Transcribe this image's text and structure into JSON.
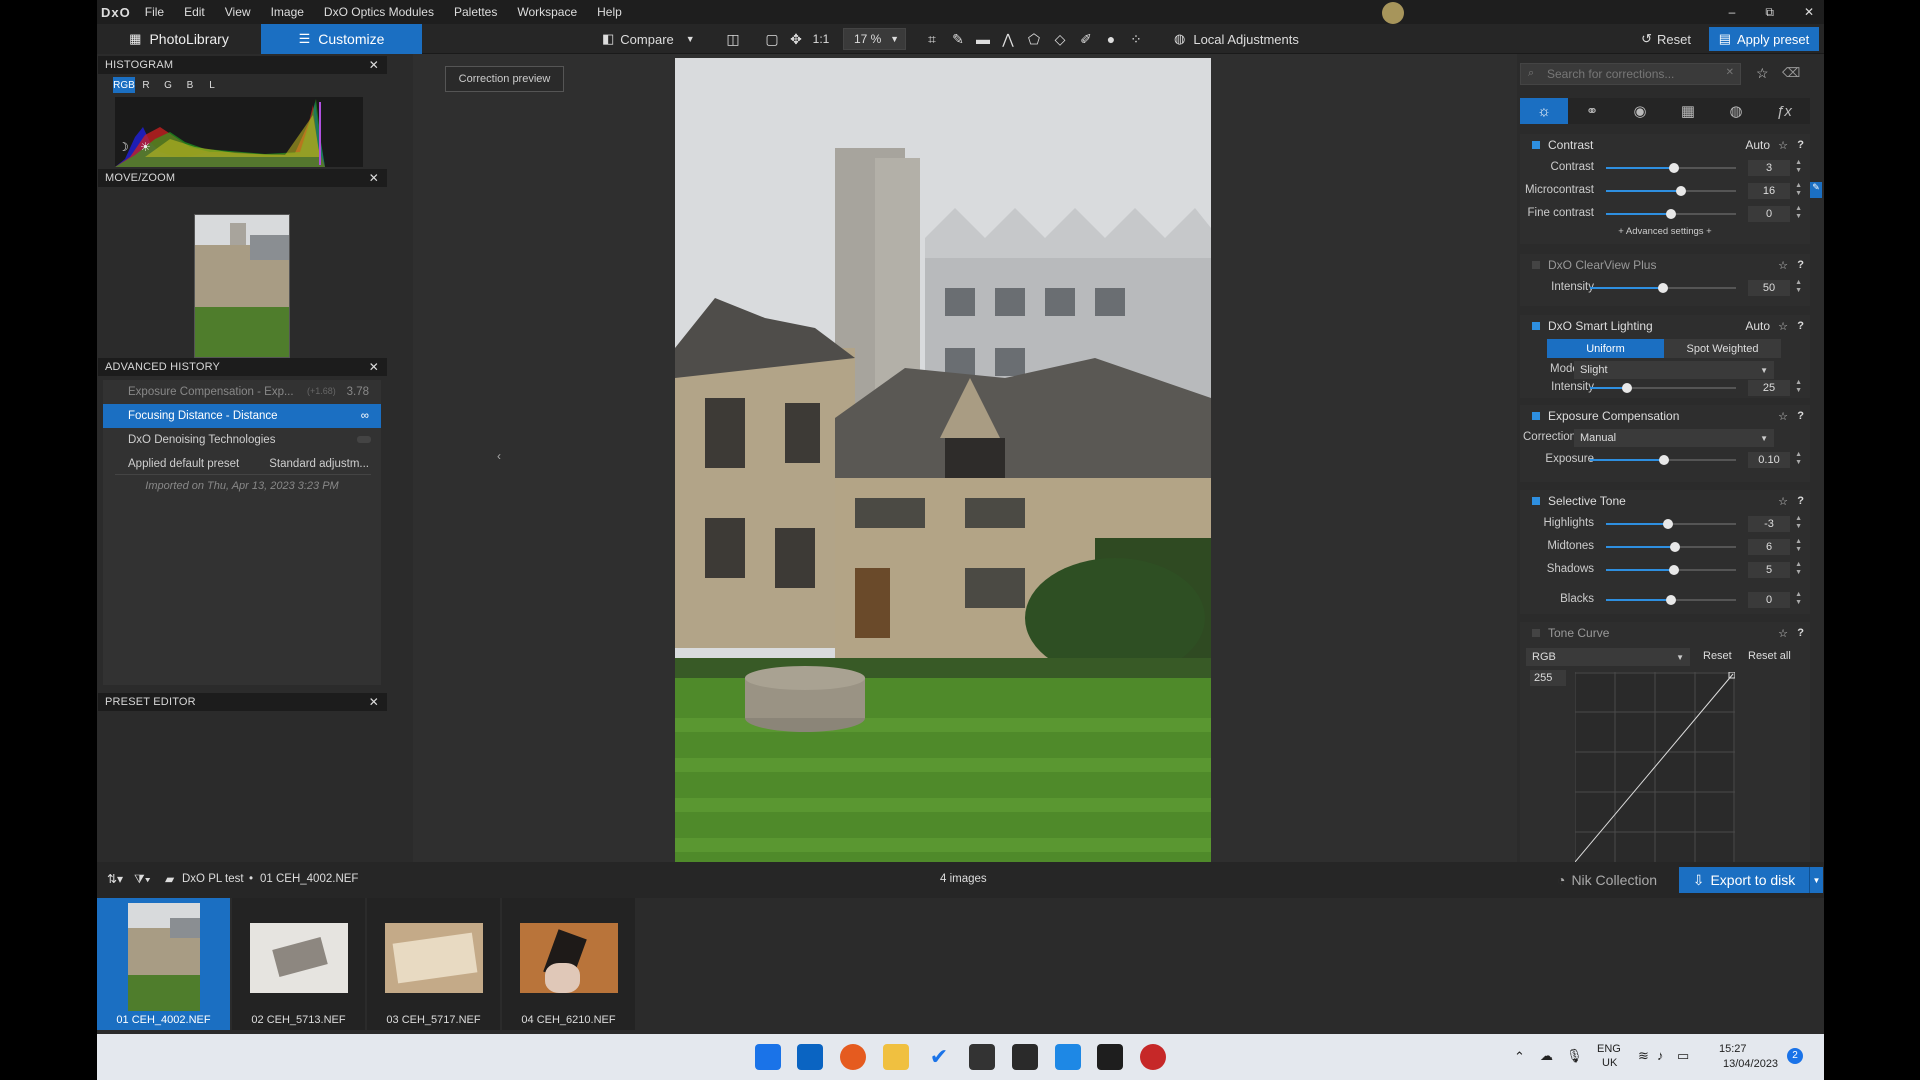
{
  "app": {
    "logo": "DxO"
  },
  "menu": [
    "File",
    "Edit",
    "View",
    "Image",
    "DxO Optics Modules",
    "Palettes",
    "Workspace",
    "Help"
  ],
  "window_controls": {
    "minimize": "–",
    "maximize": "⧉",
    "close": "✕"
  },
  "toolbar": {
    "tab_photolibrary": "PhotoLibrary",
    "tab_customize": "Customize",
    "compare": "Compare",
    "one_to_one": "1:1",
    "zoom": "17 %",
    "local_adjustments": "Local Adjustments",
    "reset": "Reset",
    "apply_preset": "Apply preset"
  },
  "left": {
    "histogram": {
      "title": "HISTOGRAM",
      "channels": [
        "RGB",
        "R",
        "G",
        "B",
        "L"
      ],
      "active_channel": "RGB"
    },
    "move_zoom": {
      "title": "MOVE/ZOOM"
    },
    "history": {
      "title": "ADVANCED HISTORY",
      "items": [
        {
          "label": "Exposure Compensation - Exp...",
          "from": "(+1.68)",
          "value": "3.78"
        },
        {
          "label": "Focusing Distance - Distance",
          "value": "∞"
        },
        {
          "label": "DxO Denoising Technologies",
          "value": ""
        },
        {
          "label": "Applied default preset",
          "value": "Standard adjustm..."
        }
      ],
      "imported": "Imported on Thu, Apr 13, 2023 3:23 PM"
    },
    "preset_editor": {
      "title": "PRESET EDITOR"
    }
  },
  "viewer": {
    "correction_preview": "Correction preview"
  },
  "right": {
    "search_placeholder": "Search for corrections...",
    "contrast": {
      "title": "Contrast",
      "auto": "Auto",
      "advanced": "+ Advanced settings +",
      "rows": [
        {
          "label": "Contrast",
          "value": "3",
          "level": 0.52
        },
        {
          "label": "Microcontrast",
          "value": "16",
          "level": 0.58
        },
        {
          "label": "Fine contrast",
          "value": "0",
          "level": 0.5
        }
      ]
    },
    "clearview": {
      "title": "DxO ClearView Plus",
      "rows": [
        {
          "label": "Intensity",
          "value": "50",
          "level": 0.5
        }
      ]
    },
    "smart_lighting": {
      "title": "DxO Smart Lighting",
      "auto": "Auto",
      "mode_uniform": "Uniform",
      "mode_spot": "Spot Weighted",
      "mode_label": "Mode",
      "mode_value": "Slight",
      "rows": [
        {
          "label": "Intensity",
          "value": "25",
          "level": 0.25
        }
      ]
    },
    "exposure": {
      "title": "Exposure Compensation",
      "correction_label": "Correction",
      "correction_value": "Manual",
      "rows": [
        {
          "label": "Exposure",
          "value": "0.10",
          "level": 0.51
        }
      ]
    },
    "selective_tone": {
      "title": "Selective Tone",
      "rows": [
        {
          "label": "Highlights",
          "value": "-3",
          "level": 0.48
        },
        {
          "label": "Midtones",
          "value": "6",
          "level": 0.53
        },
        {
          "label": "Shadows",
          "value": "5",
          "level": 0.52
        },
        {
          "label": "Blacks",
          "value": "0",
          "level": 0.5
        }
      ]
    },
    "tone_curve": {
      "title": "Tone Curve",
      "channel": "RGB",
      "reset": "Reset",
      "reset_all": "Reset all",
      "value": "255"
    }
  },
  "filmstrip": {
    "breadcrumb_folder": "DxO PL test",
    "breadcrumb_file": "01 CEH_4002.NEF",
    "count": "4 images",
    "nik": "Nik Collection",
    "export": "Export to disk",
    "items": [
      {
        "label": "01 CEH_4002.NEF",
        "selected": true
      },
      {
        "label": "02 CEH_5713.NEF",
        "selected": false
      },
      {
        "label": "03 CEH_5717.NEF",
        "selected": false
      },
      {
        "label": "04 CEH_6210.NEF",
        "selected": false
      }
    ]
  },
  "taskbar": {
    "lang1": "ENG",
    "lang2": "UK",
    "time": "15:27",
    "date": "13/04/2023",
    "notifications": "2"
  }
}
